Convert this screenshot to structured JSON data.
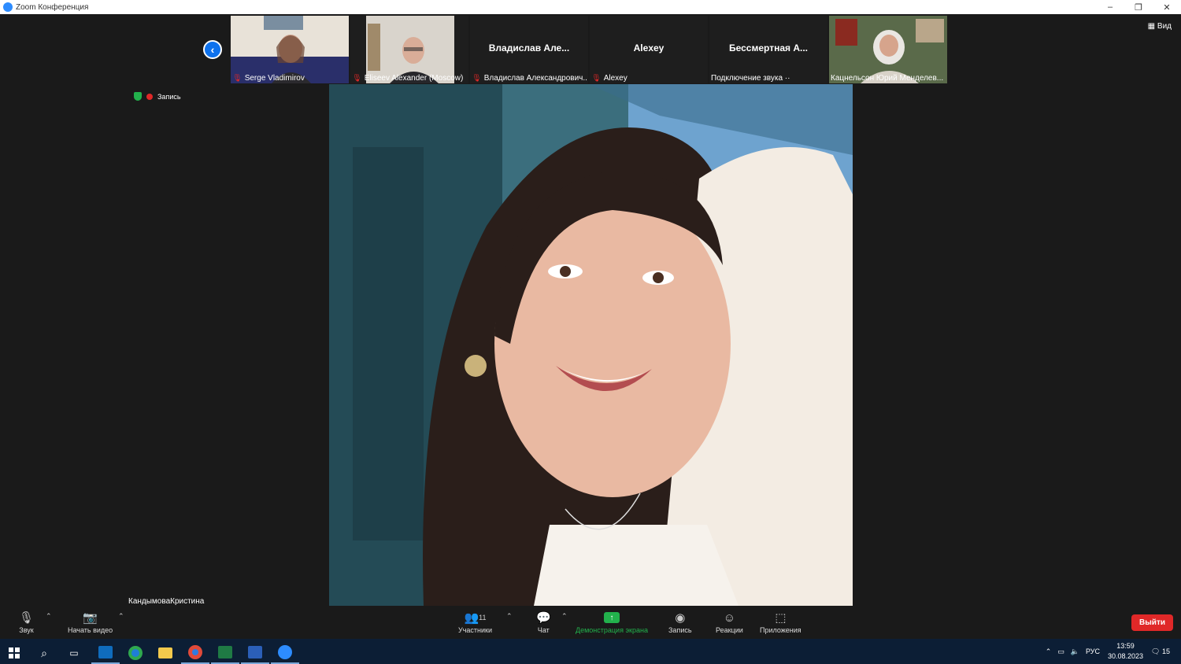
{
  "window": {
    "title": "Zoom Конференция",
    "minimize": "–",
    "restore": "❐",
    "close": "✕"
  },
  "top_right": {
    "view_label": "Вид"
  },
  "security": {
    "recording_label": "Запись"
  },
  "participants_strip": [
    {
      "name": "Serge Vladimirov",
      "muted": true,
      "video": true
    },
    {
      "name": "Eliseev Alexander (Moscow)",
      "muted": true,
      "video": true
    },
    {
      "name": "Владислав Александрович...",
      "display": "Владислав  Але...",
      "muted": true,
      "video": false
    },
    {
      "name": "Alexey",
      "display": "Alexey",
      "muted": true,
      "video": false
    },
    {
      "name": "Подключение звука ··",
      "display": "Бессмертная  А...",
      "muted": false,
      "video": false
    },
    {
      "name": "Кацнельсон Юрий Менделев...",
      "muted": false,
      "video": true
    }
  ],
  "active_speaker": {
    "name": "КандымоваКристина"
  },
  "toolbar": {
    "audio_label": "Звук",
    "video_label": "Начать видео",
    "participants_label": "Участники",
    "participants_count": "11",
    "chat_label": "Чат",
    "share_label": "Демонстрация экрана",
    "record_label": "Запись",
    "reactions_label": "Реакции",
    "apps_label": "Приложения",
    "leave_label": "Выйти"
  },
  "taskbar": {
    "language": "РУС",
    "time": "13:59",
    "date": "30.08.2023",
    "notifications": "15"
  }
}
